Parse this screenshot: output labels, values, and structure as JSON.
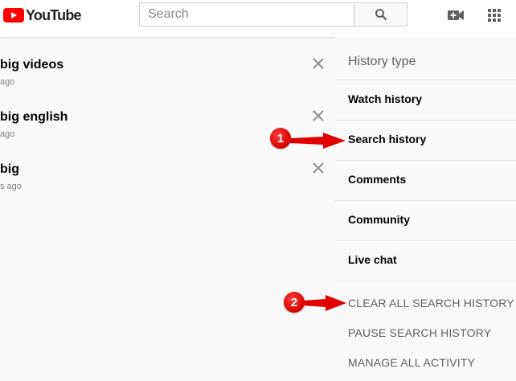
{
  "header": {
    "logo_text": "YouTube",
    "search_placeholder": "Search"
  },
  "history_results": [
    {
      "title": "big videos",
      "time": "ago"
    },
    {
      "title": "big english",
      "time": "ago"
    },
    {
      "title": "big",
      "time": "s ago"
    }
  ],
  "sidebar": {
    "heading": "History type",
    "types": [
      "Watch history",
      "Search history",
      "Comments",
      "Community",
      "Live chat"
    ],
    "actions": [
      "CLEAR ALL SEARCH HISTORY",
      "PAUSE SEARCH HISTORY",
      "MANAGE ALL ACTIVITY"
    ]
  },
  "annotations": [
    {
      "number": "1",
      "points_to": "Search history"
    },
    {
      "number": "2",
      "points_to": "CLEAR ALL SEARCH HISTORY"
    }
  ],
  "colors": {
    "brand_red": "#ff0000",
    "annotation_red": "#e00000",
    "background": "#f9f9f9"
  }
}
